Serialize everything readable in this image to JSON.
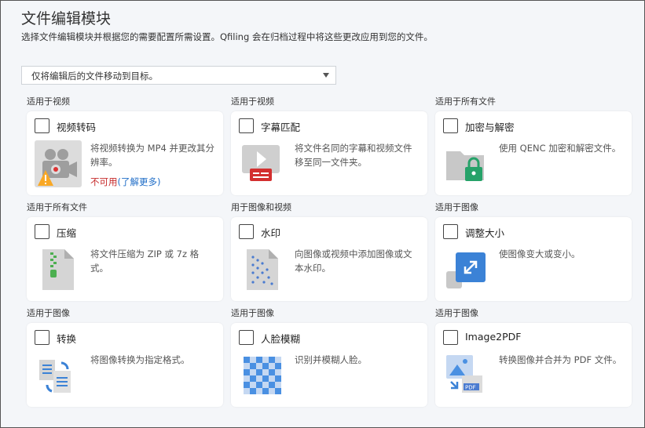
{
  "header": {
    "title": "文件编辑模块",
    "description": "选择文件编辑模块并根据您的需要配置所需设置。Qfiling 会在归档过程中将这些更改应用到您的文件。"
  },
  "select": {
    "value": "仅将编辑后的文件移动到目标。"
  },
  "modules": [
    {
      "category": "适用于视频",
      "name": "视频转码",
      "desc": "将视频转换为 MP4 并更改其分辨率。",
      "icon": "video-camera-warning-icon",
      "status": "不可用",
      "link": "(了解更多)"
    },
    {
      "category": "适用于视频",
      "name": "字幕匹配",
      "desc": "将文件名同的字幕和视频文件移至同一文件夹。",
      "icon": "subtitle-video-icon"
    },
    {
      "category": "适用于所有文件",
      "name": "加密与解密",
      "desc": "使用 QENC 加密和解密文件。",
      "icon": "folder-lock-icon"
    },
    {
      "category": "适用于所有文件",
      "name": "压缩",
      "desc": "将文件压缩为 ZIP 或 7z 格式。",
      "icon": "zip-file-icon"
    },
    {
      "category": "用于图像和视频",
      "name": "水印",
      "desc": "向图像或视频中添加图像或文本水印。",
      "icon": "watermark-icon"
    },
    {
      "category": "适用于图像",
      "name": "调整大小",
      "desc": "使图像变大或变小。",
      "icon": "resize-icon"
    },
    {
      "category": "适用于图像",
      "name": "转换",
      "desc": "将图像转换为指定格式。",
      "icon": "convert-icon"
    },
    {
      "category": "适用于图像",
      "name": "人脸模糊",
      "desc": "识别并模糊人脸。",
      "icon": "face-blur-icon"
    },
    {
      "category": "适用于图像",
      "name": "Image2PDF",
      "desc": "转换图像并合并为 PDF 文件。",
      "icon": "image-to-pdf-icon"
    }
  ]
}
